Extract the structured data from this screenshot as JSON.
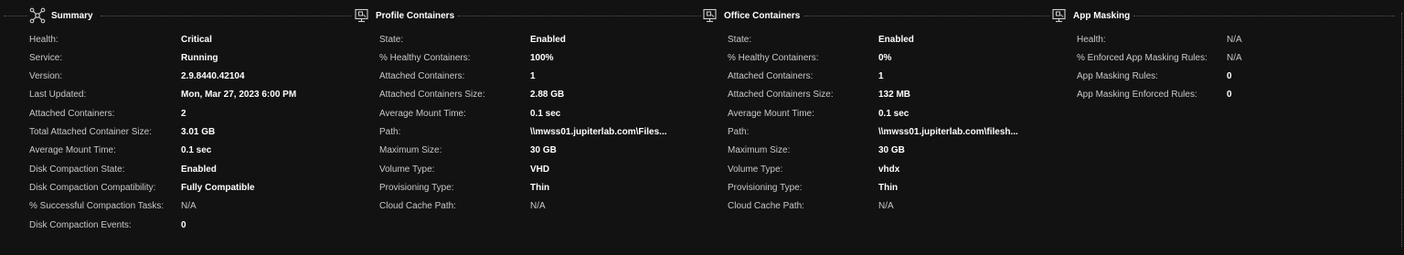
{
  "sections": {
    "summary": {
      "title": "Summary",
      "icon": "network-nodes-icon",
      "rows": [
        {
          "label": "Health:",
          "value": "Critical"
        },
        {
          "label": "Service:",
          "value": "Running"
        },
        {
          "label": "Version:",
          "value": "2.9.8440.42104"
        },
        {
          "label": "Last Updated:",
          "value": "Mon, Mar 27, 2023 6:00 PM"
        },
        {
          "label": "Attached Containers:",
          "value": "2"
        },
        {
          "label": "Total Attached Container Size:",
          "value": "3.01 GB"
        },
        {
          "label": "Average Mount Time:",
          "value": "0.1 sec"
        },
        {
          "label": "Disk Compaction State:",
          "value": "Enabled"
        },
        {
          "label": "Disk Compaction Compatibility:",
          "value": "Fully Compatible"
        },
        {
          "label": "% Successful Compaction Tasks:",
          "value": "N/A"
        },
        {
          "label": "Disk Compaction Events:",
          "value": "0"
        }
      ]
    },
    "profile": {
      "title": "Profile Containers",
      "icon": "container-screen-icon",
      "rows": [
        {
          "label": "State:",
          "value": "Enabled"
        },
        {
          "label": "% Healthy Containers:",
          "value": "100%"
        },
        {
          "label": "Attached Containers:",
          "value": "1"
        },
        {
          "label": "Attached Containers Size:",
          "value": "2.88 GB"
        },
        {
          "label": "Average Mount Time:",
          "value": "0.1 sec"
        },
        {
          "label": "Path:",
          "value": "\\\\mwss01.jupiterlab.com\\Files..."
        },
        {
          "label": "Maximum Size:",
          "value": "30 GB"
        },
        {
          "label": "Volume Type:",
          "value": "VHD"
        },
        {
          "label": "Provisioning Type:",
          "value": "Thin"
        },
        {
          "label": "Cloud Cache Path:",
          "value": "N/A"
        }
      ]
    },
    "office": {
      "title": "Office Containers",
      "icon": "container-screen-icon",
      "rows": [
        {
          "label": "State:",
          "value": "Enabled"
        },
        {
          "label": "% Healthy Containers:",
          "value": "0%"
        },
        {
          "label": "Attached Containers:",
          "value": "1"
        },
        {
          "label": "Attached Containers Size:",
          "value": "132 MB"
        },
        {
          "label": "Average Mount Time:",
          "value": "0.1 sec"
        },
        {
          "label": "Path:",
          "value": "\\\\mwss01.jupiterlab.com\\filesh..."
        },
        {
          "label": "Maximum Size:",
          "value": "30 GB"
        },
        {
          "label": "Volume Type:",
          "value": "vhdx"
        },
        {
          "label": "Provisioning Type:",
          "value": "Thin"
        },
        {
          "label": "Cloud Cache Path:",
          "value": "N/A"
        }
      ]
    },
    "appmasking": {
      "title": "App Masking",
      "icon": "container-screen-icon",
      "rows": [
        {
          "label": "Health:",
          "value": "N/A"
        },
        {
          "label": "% Enforced App Masking Rules:",
          "value": "N/A"
        },
        {
          "label": "App Masking Rules:",
          "value": "0"
        },
        {
          "label": "App Masking Enforced Rules:",
          "value": "0"
        }
      ]
    }
  },
  "colors": {
    "background": "#121212",
    "label": "#c8c8c8",
    "value": "#ffffff",
    "divider": "#5a5a5a"
  }
}
